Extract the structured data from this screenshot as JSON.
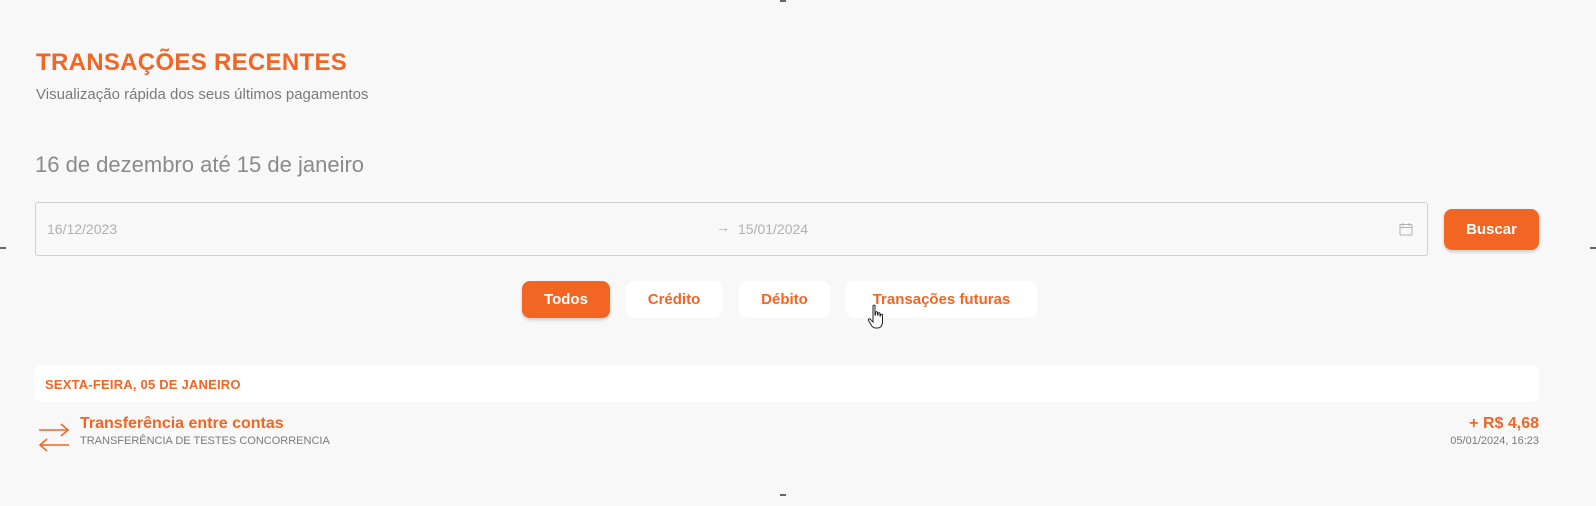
{
  "header": {
    "title": "TRANSAÇÕES RECENTES",
    "subtitle": "Visualização rápida dos seus últimos pagamentos"
  },
  "period_label": "16 de dezembro até 15 de janeiro",
  "date_range": {
    "start": "16/12/2023",
    "end": "15/01/2024",
    "separator_icon": "arrow-right-icon",
    "calendar_icon": "calendar-icon"
  },
  "search_button": "Buscar",
  "filters": [
    {
      "label": "Todos",
      "active": true
    },
    {
      "label": "Crédito",
      "active": false
    },
    {
      "label": "Débito",
      "active": false
    },
    {
      "label": "Transações futuras",
      "active": false
    }
  ],
  "groups": [
    {
      "day": "SEXTA-FEIRA, 05 DE JANEIRO",
      "transactions": [
        {
          "name": "Transferência entre contas",
          "description": "TRANSFERÊNCIA DE TESTES CONCORRENCIA",
          "amount": "+ R$ 4,68",
          "datetime": "05/01/2024, 16:23",
          "icon": "transfer-arrows-icon"
        }
      ]
    }
  ],
  "colors": {
    "accent": "#f26522",
    "background": "#f8f8f8",
    "muted_text": "#7a7a7a"
  }
}
